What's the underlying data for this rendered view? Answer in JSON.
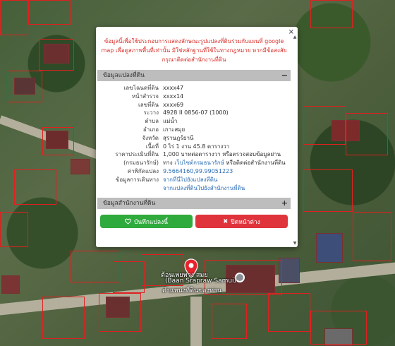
{
  "map": {
    "place_label_th": "ต้อนเพยพวง สมย",
    "place_label_en": "(Baan Srapraw Samui)",
    "place_label_th2": "ตำแหน่งที่ดินของท่าน",
    "pin_color": "#e8222c"
  },
  "popup": {
    "close_label": "×",
    "notice": "ข้อมูลนี้เพื่อใช้ประกอบการแสดงลักษณะรูปแปลงที่ดินร่วมกับแผนที่ google map เพื่อดูสภาพพื้นที่เท่านั้น มิใช่หลักฐานที่ใช้ในทางกฎหมาย หากมีข้อสงสัย กรุณาติดต่อสำนักงานที่ดิน",
    "section1_title": "ข้อมูลแปลงที่ดิน",
    "section1_toggle": "−",
    "rows": [
      {
        "k": "เลขโฉนดที่ดิน",
        "v": "xxxx47"
      },
      {
        "k": "หน้าสำรวจ",
        "v": "xxxx14"
      },
      {
        "k": "เลขที่ดิน",
        "v": "xxxx69"
      },
      {
        "k": "ระวาง",
        "v": "4928 II 0856-07 (1000)"
      },
      {
        "k": "ตำบล",
        "v": "แม่น้ำ"
      },
      {
        "k": "อำเภอ",
        "v": "เกาะสมุย"
      },
      {
        "k": "จังหวัด",
        "v": "สุราษฎร์ธานี"
      },
      {
        "k": "เนื้อที่",
        "v": "0 ไร่ 1 งาน 45.8 ตารางวา"
      },
      {
        "k": "ราคาประเมินที่ดิน",
        "v": "1,000 บาทต่อตารางวา หรือตรวจสอบข้อมูลผ่าน"
      },
      {
        "k": "(กรมธนารักษ์)",
        "v_prefix": "ทาง ",
        "v_link": "เว็บไซต์กรมธนารักษ์",
        "v_suffix": " หรือติดต่อสำนักงานที่ดิน"
      },
      {
        "k": "ค่าพิกัดแปลง",
        "v_link": "9.5664160,99.99051223"
      },
      {
        "k": "ข้อมูลการเดินทาง",
        "v_link": "จากที่นี่ไปยังแปลงที่ดิน"
      },
      {
        "k": "",
        "v_link": "จากแปลงที่ดินไปยังสำนักงานที่ดิน"
      }
    ],
    "section2_title": "ข้อมูลสำนักงานที่ดิน",
    "section2_toggle": "+",
    "save_label": "บันทึกแปลงนี้",
    "close_window_label": "ปิดหน้าต่าง"
  }
}
